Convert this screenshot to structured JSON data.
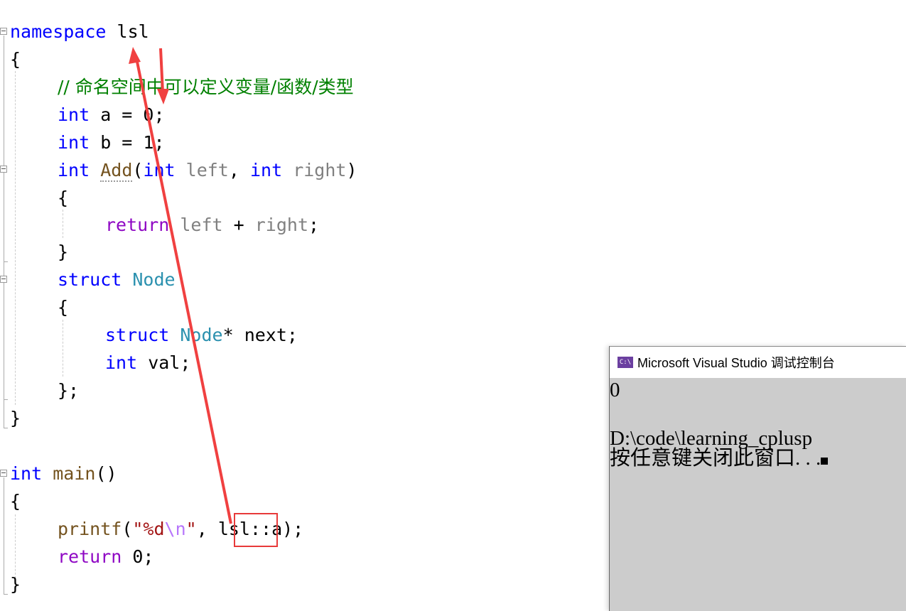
{
  "editor": {
    "lines": {
      "l1": {
        "kw": "namespace",
        "name": "lsl"
      },
      "l2": {
        "text": "{"
      },
      "l3": {
        "comment": "// 命名空间中可以定义变量/函数/类型"
      },
      "l4": {
        "kw": "int",
        "rest": " a = 0;"
      },
      "l5": {
        "kw": "int",
        "rest": " b = 1;"
      },
      "l6": {
        "kw": "int",
        "fn": "Add",
        "open": "(",
        "kw2": "int",
        "p1": "left",
        "comma": ", ",
        "kw3": "int",
        "p2": "right",
        "close": ")"
      },
      "l7": {
        "text": "{"
      },
      "l8": {
        "kw": "return",
        "p1": "left",
        "op": " + ",
        "p2": "right",
        "semi": ";"
      },
      "l9": {
        "text": "}"
      },
      "l10": {
        "kw": "struct",
        "type": "Node"
      },
      "l11": {
        "text": "{"
      },
      "l12": {
        "kw": "struct",
        "type": "Node",
        "rest": "* next;"
      },
      "l13": {
        "kw": "int",
        "rest": " val;"
      },
      "l14": {
        "text": "};"
      },
      "l15": {
        "text": "}"
      },
      "l16": {
        "kw": "int",
        "fn": "main",
        "rest": "()"
      },
      "l17": {
        "text": "{"
      },
      "l18": {
        "fn": "printf",
        "open": "(",
        "str1": "\"%d",
        "esc": "\\n",
        "str2": "\"",
        "comma": ", ",
        "ns": "lsl",
        "rest": "::a);"
      },
      "l19": {
        "kw": "return",
        "rest": " 0;"
      },
      "l20": {
        "text": "}"
      }
    }
  },
  "console": {
    "title": "Microsoft Visual Studio 调试控制台",
    "icon_label": "C:\\",
    "output_lines": [
      "0",
      "",
      "D:\\code\\learning_cplusp",
      "按任意键关闭此窗口. . ."
    ]
  },
  "annotations": {
    "color": "#e83a3a",
    "highlight_target": "lsl"
  }
}
